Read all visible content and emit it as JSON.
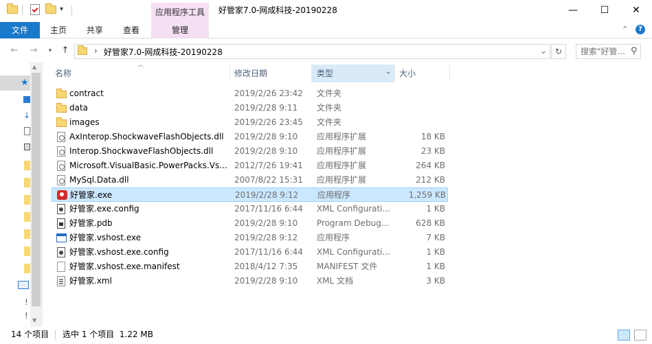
{
  "window": {
    "title": "好管家7.0-网成科技-20190228",
    "tools_tab": "应用程序工具",
    "minimize": "—",
    "maximize": "☐",
    "close": "✕"
  },
  "ribbon": {
    "file": "文件",
    "tabs": [
      "主页",
      "共享",
      "查看",
      "管理"
    ]
  },
  "address": {
    "path": "好管家7.0-网成科技-20190228",
    "search_placeholder": "搜索\"好管...",
    "sep": "›",
    "back": "←",
    "forward": "→",
    "up": "↑",
    "dropdown": "⌄",
    "refresh": "↻",
    "search_icon": "⚲"
  },
  "columns": {
    "name": "名称",
    "date": "修改日期",
    "type": "类型",
    "size": "大小"
  },
  "files": [
    {
      "name": "contract",
      "date": "2019/2/26 23:42",
      "type": "文件夹",
      "size": "",
      "icon": "folder"
    },
    {
      "name": "data",
      "date": "2019/2/28 9:11",
      "type": "文件夹",
      "size": "",
      "icon": "folder"
    },
    {
      "name": "images",
      "date": "2019/2/26 23:45",
      "type": "文件夹",
      "size": "",
      "icon": "folder"
    },
    {
      "name": "AxInterop.ShockwaveFlashObjects.dll",
      "date": "2019/2/28 9:10",
      "type": "应用程序扩展",
      "size": "18 KB",
      "icon": "dll"
    },
    {
      "name": "Interop.ShockwaveFlashObjects.dll",
      "date": "2019/2/28 9:10",
      "type": "应用程序扩展",
      "size": "23 KB",
      "icon": "dll"
    },
    {
      "name": "Microsoft.VisualBasic.PowerPacks.Vs....",
      "date": "2012/7/26 19:41",
      "type": "应用程序扩展",
      "size": "264 KB",
      "icon": "dll"
    },
    {
      "name": "MySql.Data.dll",
      "date": "2007/8/22 15:31",
      "type": "应用程序扩展",
      "size": "212 KB",
      "icon": "dll"
    },
    {
      "name": "好管家.exe",
      "date": "2019/2/28 9:12",
      "type": "应用程序",
      "size": "1,259 KB",
      "icon": "exe",
      "selected": true
    },
    {
      "name": "好管家.exe.config",
      "date": "2017/11/16 6:44",
      "type": "XML Configurati...",
      "size": "1 KB",
      "icon": "config"
    },
    {
      "name": "好管家.pdb",
      "date": "2019/2/28 9:10",
      "type": "Program Debug...",
      "size": "628 KB",
      "icon": "pdb"
    },
    {
      "name": "好管家.vshost.exe",
      "date": "2019/2/28 9:12",
      "type": "应用程序",
      "size": "7 KB",
      "icon": "app"
    },
    {
      "name": "好管家.vshost.exe.config",
      "date": "2017/11/16 6:44",
      "type": "XML Configurati...",
      "size": "1 KB",
      "icon": "config"
    },
    {
      "name": "好管家.vshost.exe.manifest",
      "date": "2018/4/12 7:35",
      "type": "MANIFEST 文件",
      "size": "1 KB",
      "icon": "file"
    },
    {
      "name": "好管家.xml",
      "date": "2019/2/28 9:10",
      "type": "XML 文档",
      "size": "3 KB",
      "icon": "xml"
    }
  ],
  "status": {
    "count": "14 个项目",
    "selection": "选中 1 个项目  1.22 MB"
  },
  "colors": {
    "accent": "#1979ca",
    "selection": "#cce8ff",
    "tools_tab": "#f4dff3"
  }
}
